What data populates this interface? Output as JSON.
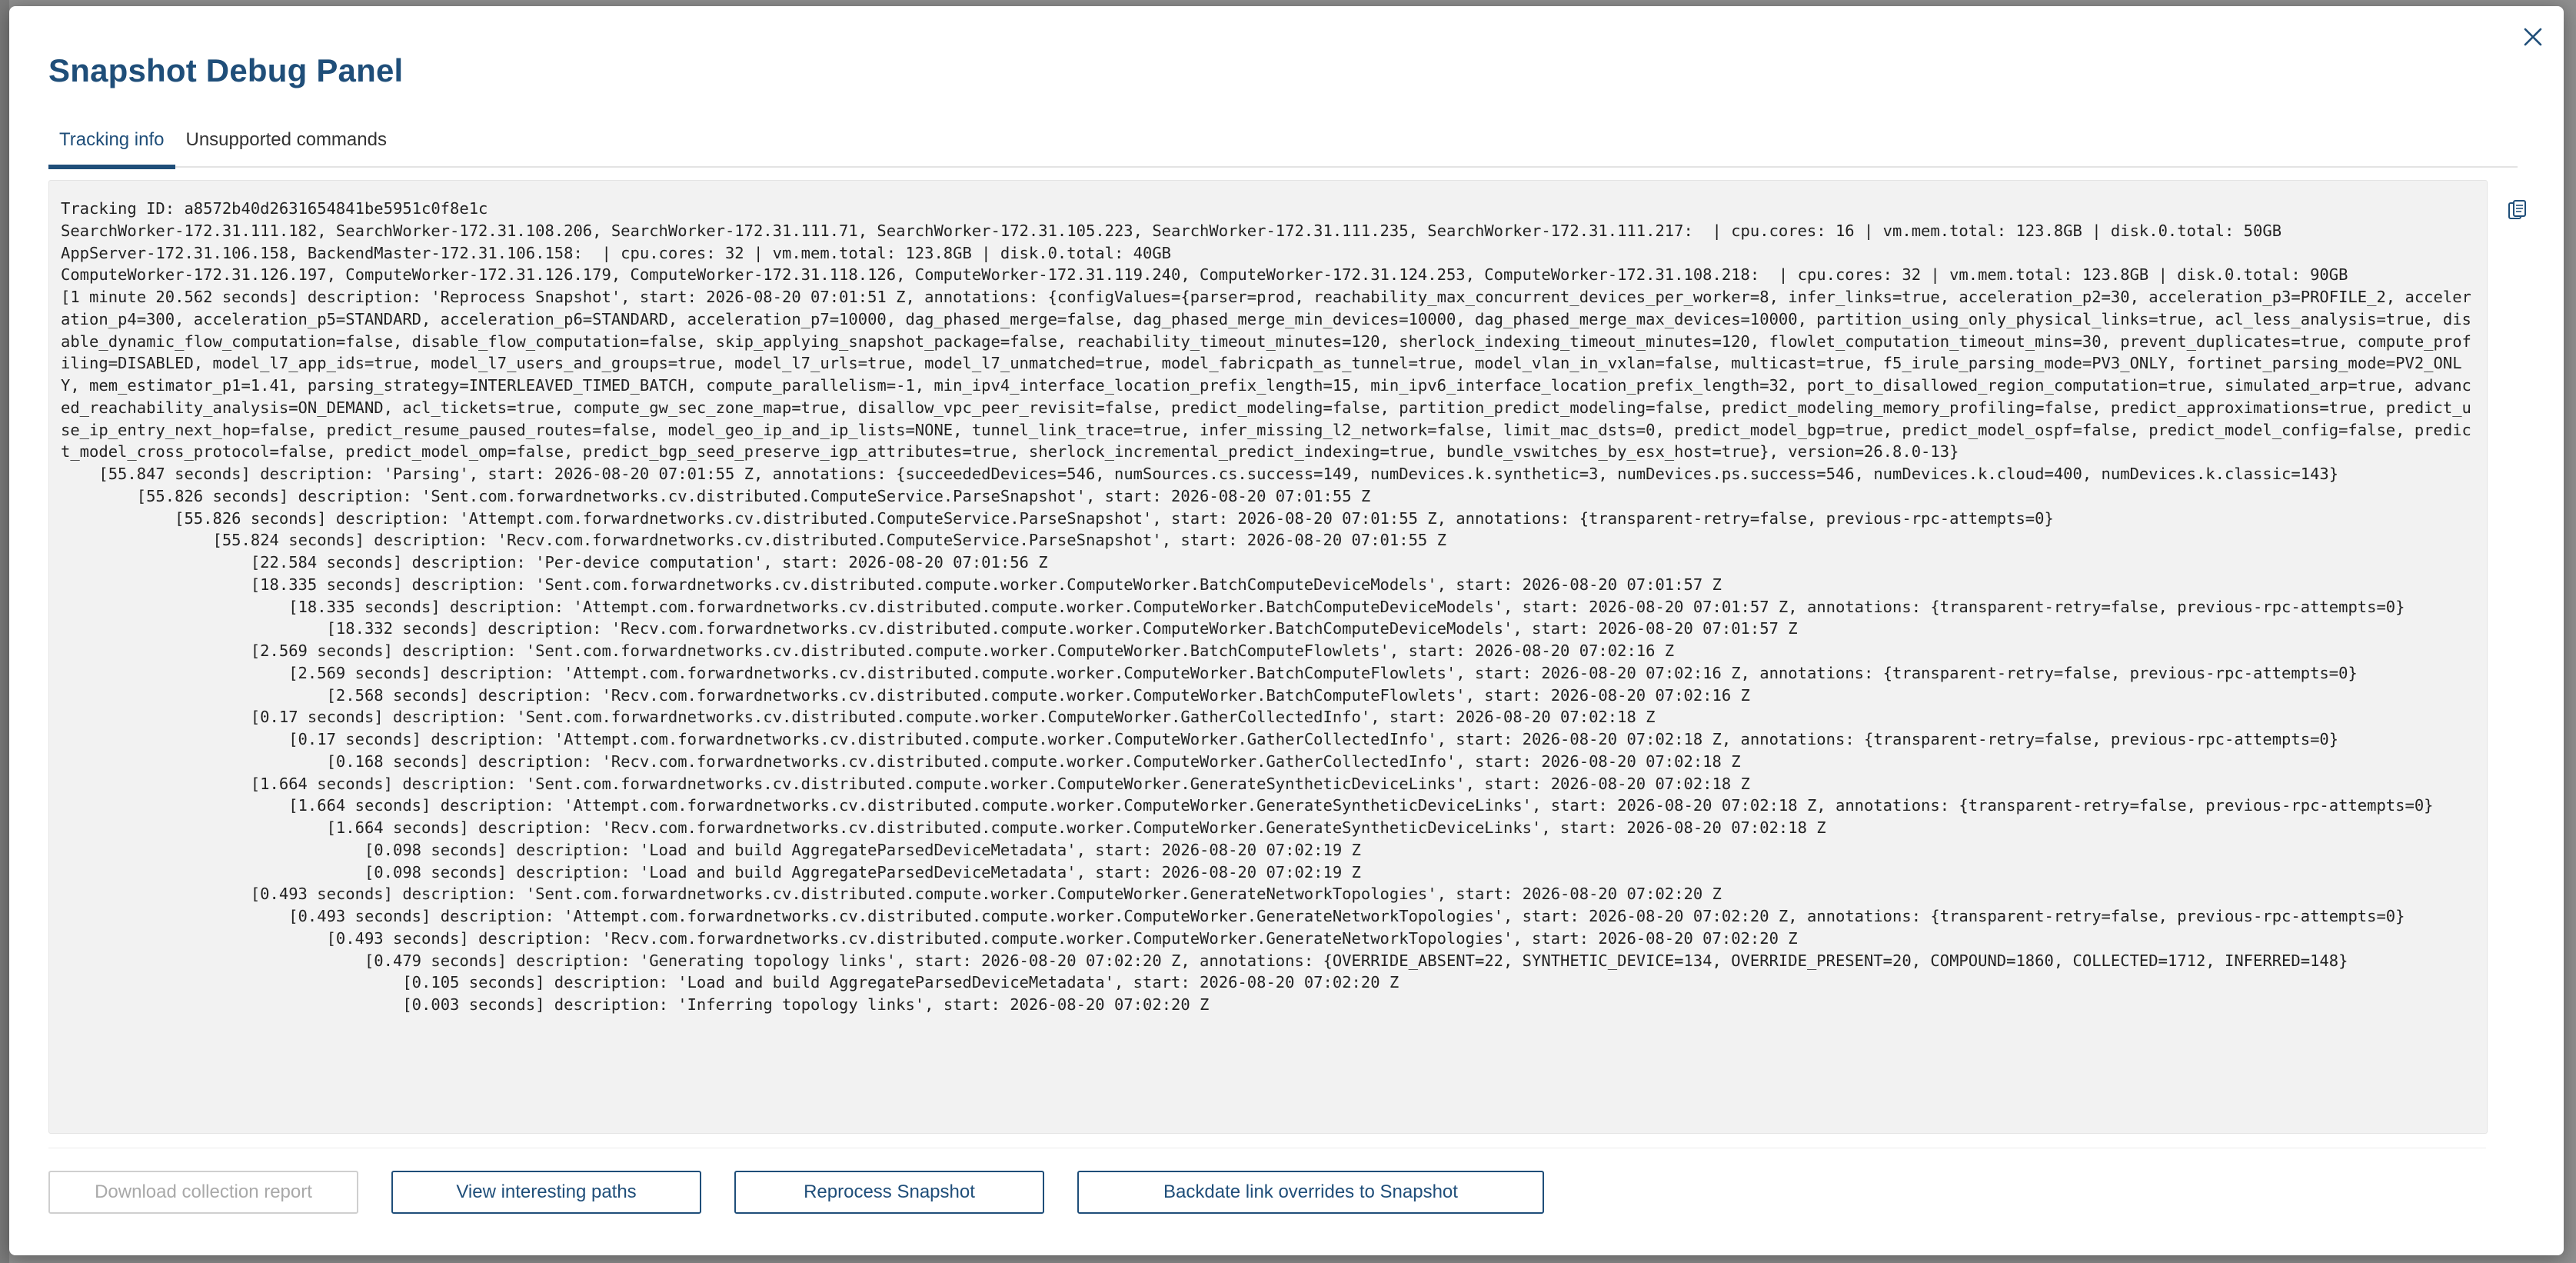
{
  "modal": {
    "title": "Snapshot Debug Panel",
    "close_icon": "close-icon",
    "copy_icon": "clipboard-icon"
  },
  "tabs": [
    {
      "label": "Tracking info",
      "active": true
    },
    {
      "label": "Unsupported commands",
      "active": false
    }
  ],
  "log_lines": [
    "Tracking ID: a8572b40d2631654841be5951c0f8e1c",
    "SearchWorker-172.31.111.182, SearchWorker-172.31.108.206, SearchWorker-172.31.111.71, SearchWorker-172.31.105.223, SearchWorker-172.31.111.235, SearchWorker-172.31.111.217:  | cpu.cores: 16 | vm.mem.total: 123.8GB | disk.0.total: 50GB",
    "AppServer-172.31.106.158, BackendMaster-172.31.106.158:  | cpu.cores: 32 | vm.mem.total: 123.8GB | disk.0.total: 40GB",
    "ComputeWorker-172.31.126.197, ComputeWorker-172.31.126.179, ComputeWorker-172.31.118.126, ComputeWorker-172.31.119.240, ComputeWorker-172.31.124.253, ComputeWorker-172.31.108.218:  | cpu.cores: 32 | vm.mem.total: 123.8GB | disk.0.total: 90GB",
    "[1 minute 20.562 seconds] description: 'Reprocess Snapshot', start: 2026-08-20 07:01:51 Z, annotations: {configValues={parser=prod, reachability_max_concurrent_devices_per_worker=8, infer_links=true, acceleration_p2=30, acceleration_p3=PROFILE_2, acceleration_p4=300, acceleration_p5=STANDARD, acceleration_p6=STANDARD, acceleration_p7=10000, dag_phased_merge=false, dag_phased_merge_min_devices=10000, dag_phased_merge_max_devices=10000, partition_using_only_physical_links=true, acl_less_analysis=true, disable_dynamic_flow_computation=false, disable_flow_computation=false, skip_applying_snapshot_package=false, reachability_timeout_minutes=120, sherlock_indexing_timeout_minutes=120, flowlet_computation_timeout_mins=30, prevent_duplicates=true, compute_profiling=DISABLED, model_l7_app_ids=true, model_l7_users_and_groups=true, model_l7_urls=true, model_l7_unmatched=true, model_fabricpath_as_tunnel=true, model_vlan_in_vxlan=false, multicast=true, f5_irule_parsing_mode=PV3_ONLY, fortinet_parsing_mode=PV2_ONLY, mem_estimator_p1=1.41, parsing_strategy=INTERLEAVED_TIMED_BATCH, compute_parallelism=-1, min_ipv4_interface_location_prefix_length=15, min_ipv6_interface_location_prefix_length=32, port_to_disallowed_region_computation=true, simulated_arp=true, advanced_reachability_analysis=ON_DEMAND, acl_tickets=true, compute_gw_sec_zone_map=true, disallow_vpc_peer_revisit=false, predict_modeling=false, partition_predict_modeling=false, predict_modeling_memory_profiling=false, predict_approximations=true, predict_use_ip_entry_next_hop=false, predict_resume_paused_routes=false, model_geo_ip_and_ip_lists=NONE, tunnel_link_trace=true, infer_missing_l2_network=false, limit_mac_dsts=0, predict_model_bgp=true, predict_model_ospf=false, predict_model_config=false, predict_model_cross_protocol=false, predict_model_omp=false, predict_bgp_seed_preserve_igp_attributes=true, sherlock_incremental_predict_indexing=true, bundle_vswitches_by_esx_host=true}, version=26.8.0-13}",
    "    [55.847 seconds] description: 'Parsing', start: 2026-08-20 07:01:55 Z, annotations: {succeededDevices=546, numSources.cs.success=149, numDevices.k.synthetic=3, numDevices.ps.success=546, numDevices.k.cloud=400, numDevices.k.classic=143}",
    "        [55.826 seconds] description: 'Sent.com.forwardnetworks.cv.distributed.ComputeService.ParseSnapshot', start: 2026-08-20 07:01:55 Z",
    "            [55.826 seconds] description: 'Attempt.com.forwardnetworks.cv.distributed.ComputeService.ParseSnapshot', start: 2026-08-20 07:01:55 Z, annotations: {transparent-retry=false, previous-rpc-attempts=0}",
    "                [55.824 seconds] description: 'Recv.com.forwardnetworks.cv.distributed.ComputeService.ParseSnapshot', start: 2026-08-20 07:01:55 Z",
    "                    [22.584 seconds] description: 'Per-device computation', start: 2026-08-20 07:01:56 Z",
    "                    [18.335 seconds] description: 'Sent.com.forwardnetworks.cv.distributed.compute.worker.ComputeWorker.BatchComputeDeviceModels', start: 2026-08-20 07:01:57 Z",
    "                        [18.335 seconds] description: 'Attempt.com.forwardnetworks.cv.distributed.compute.worker.ComputeWorker.BatchComputeDeviceModels', start: 2026-08-20 07:01:57 Z, annotations: {transparent-retry=false, previous-rpc-attempts=0}",
    "                            [18.332 seconds] description: 'Recv.com.forwardnetworks.cv.distributed.compute.worker.ComputeWorker.BatchComputeDeviceModels', start: 2026-08-20 07:01:57 Z",
    "                    [2.569 seconds] description: 'Sent.com.forwardnetworks.cv.distributed.compute.worker.ComputeWorker.BatchComputeFlowlets', start: 2026-08-20 07:02:16 Z",
    "                        [2.569 seconds] description: 'Attempt.com.forwardnetworks.cv.distributed.compute.worker.ComputeWorker.BatchComputeFlowlets', start: 2026-08-20 07:02:16 Z, annotations: {transparent-retry=false, previous-rpc-attempts=0}",
    "                            [2.568 seconds] description: 'Recv.com.forwardnetworks.cv.distributed.compute.worker.ComputeWorker.BatchComputeFlowlets', start: 2026-08-20 07:02:16 Z",
    "                    [0.17 seconds] description: 'Sent.com.forwardnetworks.cv.distributed.compute.worker.ComputeWorker.GatherCollectedInfo', start: 2026-08-20 07:02:18 Z",
    "                        [0.17 seconds] description: 'Attempt.com.forwardnetworks.cv.distributed.compute.worker.ComputeWorker.GatherCollectedInfo', start: 2026-08-20 07:02:18 Z, annotations: {transparent-retry=false, previous-rpc-attempts=0}",
    "                            [0.168 seconds] description: 'Recv.com.forwardnetworks.cv.distributed.compute.worker.ComputeWorker.GatherCollectedInfo', start: 2026-08-20 07:02:18 Z",
    "                    [1.664 seconds] description: 'Sent.com.forwardnetworks.cv.distributed.compute.worker.ComputeWorker.GenerateSyntheticDeviceLinks', start: 2026-08-20 07:02:18 Z",
    "                        [1.664 seconds] description: 'Attempt.com.forwardnetworks.cv.distributed.compute.worker.ComputeWorker.GenerateSyntheticDeviceLinks', start: 2026-08-20 07:02:18 Z, annotations: {transparent-retry=false, previous-rpc-attempts=0}",
    "                            [1.664 seconds] description: 'Recv.com.forwardnetworks.cv.distributed.compute.worker.ComputeWorker.GenerateSyntheticDeviceLinks', start: 2026-08-20 07:02:18 Z",
    "                                [0.098 seconds] description: 'Load and build AggregateParsedDeviceMetadata', start: 2026-08-20 07:02:19 Z",
    "                                [0.098 seconds] description: 'Load and build AggregateParsedDeviceMetadata', start: 2026-08-20 07:02:19 Z",
    "                    [0.493 seconds] description: 'Sent.com.forwardnetworks.cv.distributed.compute.worker.ComputeWorker.GenerateNetworkTopologies', start: 2026-08-20 07:02:20 Z",
    "                        [0.493 seconds] description: 'Attempt.com.forwardnetworks.cv.distributed.compute.worker.ComputeWorker.GenerateNetworkTopologies', start: 2026-08-20 07:02:20 Z, annotations: {transparent-retry=false, previous-rpc-attempts=0}",
    "                            [0.493 seconds] description: 'Recv.com.forwardnetworks.cv.distributed.compute.worker.ComputeWorker.GenerateNetworkTopologies', start: 2026-08-20 07:02:20 Z",
    "                                [0.479 seconds] description: 'Generating topology links', start: 2026-08-20 07:02:20 Z, annotations: {OVERRIDE_ABSENT=22, SYNTHETIC_DEVICE=134, OVERRIDE_PRESENT=20, COMPOUND=1860, COLLECTED=1712, INFERRED=148}",
    "                                    [0.105 seconds] description: 'Load and build AggregateParsedDeviceMetadata', start: 2026-08-20 07:02:20 Z",
    "                                    [0.003 seconds] description: 'Inferring topology links', start: 2026-08-20 07:02:20 Z"
  ],
  "footer": {
    "download_label": "Download collection report",
    "view_paths_label": "View interesting paths",
    "reprocess_label": "Reprocess Snapshot",
    "backdate_label": "Backdate link overrides to Snapshot"
  },
  "colors": {
    "accent": "#1f4e79",
    "log_background": "#f2f2f2",
    "disabled": "#a9a9a9"
  }
}
